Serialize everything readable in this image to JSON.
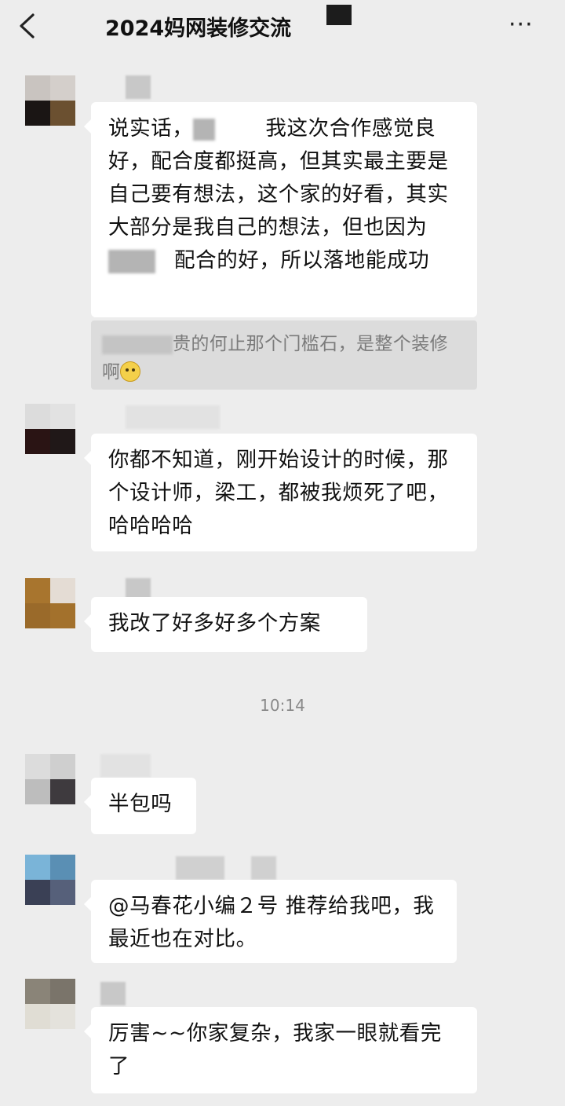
{
  "header": {
    "title": "2024妈网装修交流",
    "back_icon": "chevron-left-icon",
    "more_icon": "more-dots-icon",
    "more_label": "···"
  },
  "messages": [
    {
      "text_a": "说实话，",
      "text_b": "我这次合作感觉良好，配合度都挺高，但其实最主要是自己要有想法，这个家的好看，其实大部分是我自己的想法，但也因为",
      "text_c": "配合的好，所以落地能成功",
      "quote_text": "贵的何止那个门槛石，是整个装修啊"
    },
    {
      "text": "你都不知道，刚开始设计的时候，那个设计师，梁工，都被我烦死了吧，哈哈哈哈"
    },
    {
      "text": "我改了好多好多个方案"
    },
    {
      "text": "半包吗"
    },
    {
      "text": "@马春花小编２号  推荐给我吧，我最近也在对比。"
    },
    {
      "text": "厉害~~你家复杂，我家一眼就看完了"
    }
  ],
  "timestamp": "10:14",
  "colors": {
    "background": "#ededed",
    "bubble": "#ffffff",
    "quote_bg": "#dcdcdc",
    "timestamp": "#8a8a8a"
  }
}
